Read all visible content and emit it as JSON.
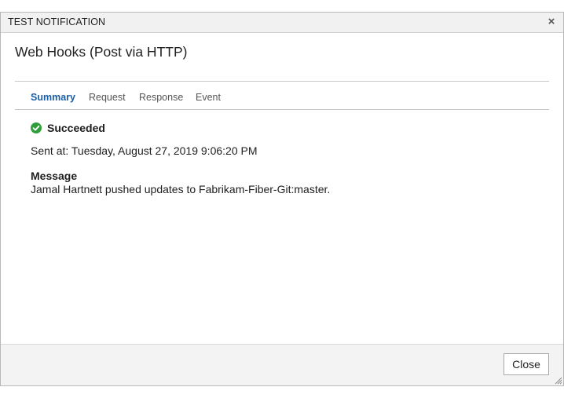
{
  "dialog": {
    "title": "TEST NOTIFICATION",
    "close_icon": "close-icon",
    "heading": "Web Hooks (Post via HTTP)"
  },
  "tabs": [
    {
      "label": "Summary",
      "active": true
    },
    {
      "label": "Request",
      "active": false
    },
    {
      "label": "Response",
      "active": false
    },
    {
      "label": "Event",
      "active": false
    }
  ],
  "summary": {
    "status_icon": "check-circle-icon",
    "status": "Succeeded",
    "sent_at": "Sent at: Tuesday, August 27, 2019 9:06:20 PM",
    "message_label": "Message",
    "message": "Jamal Hartnett pushed updates to Fabrikam-Fiber-Git:master."
  },
  "footer": {
    "close_label": "Close",
    "resize_icon": "resize-grip-icon"
  },
  "colors": {
    "accent": "#1a5fa8",
    "success": "#2e9d3a",
    "titlebar_bg": "#f1f1f1",
    "footer_bg": "#f3f3f3"
  }
}
